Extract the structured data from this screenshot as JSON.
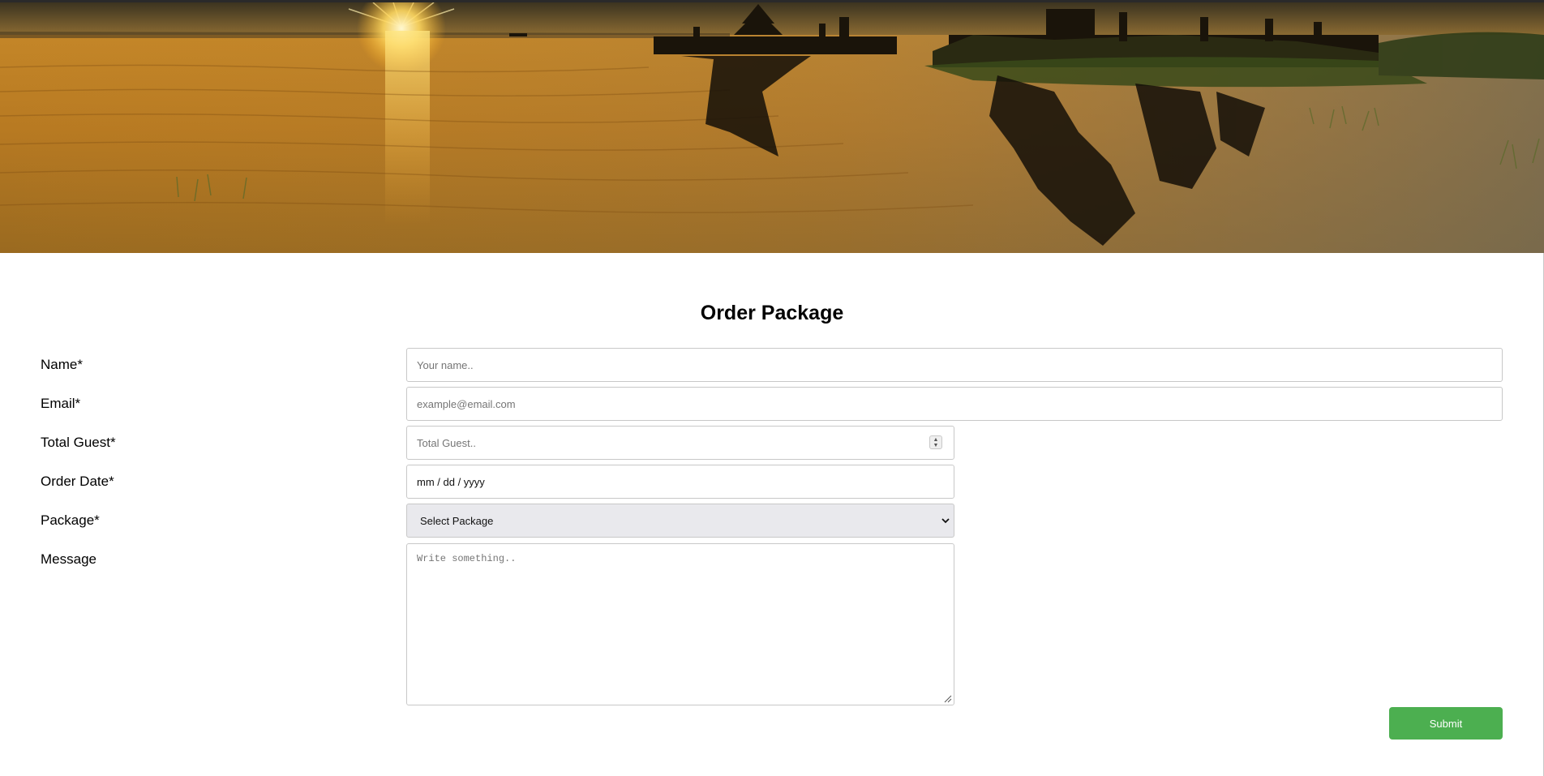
{
  "hero": {
    "image": "sunset-lake-temple-banner"
  },
  "form": {
    "title": "Order Package",
    "name": {
      "label": "Name*",
      "placeholder": "Your name.."
    },
    "email": {
      "label": "Email*",
      "placeholder": "example@email.com"
    },
    "guests": {
      "label": "Total Guest*",
      "placeholder": "Total Guest.."
    },
    "date": {
      "label": "Order Date*",
      "value": "mm / dd / yyyy"
    },
    "package": {
      "label": "Package*",
      "selected": "Select Package"
    },
    "message": {
      "label": "Message",
      "placeholder": "Write something.."
    },
    "submit_label": "Submit"
  },
  "colors": {
    "submit": "#4caf50",
    "field_border": "#c8c8c8",
    "select_bg": "#e9e9ed"
  }
}
